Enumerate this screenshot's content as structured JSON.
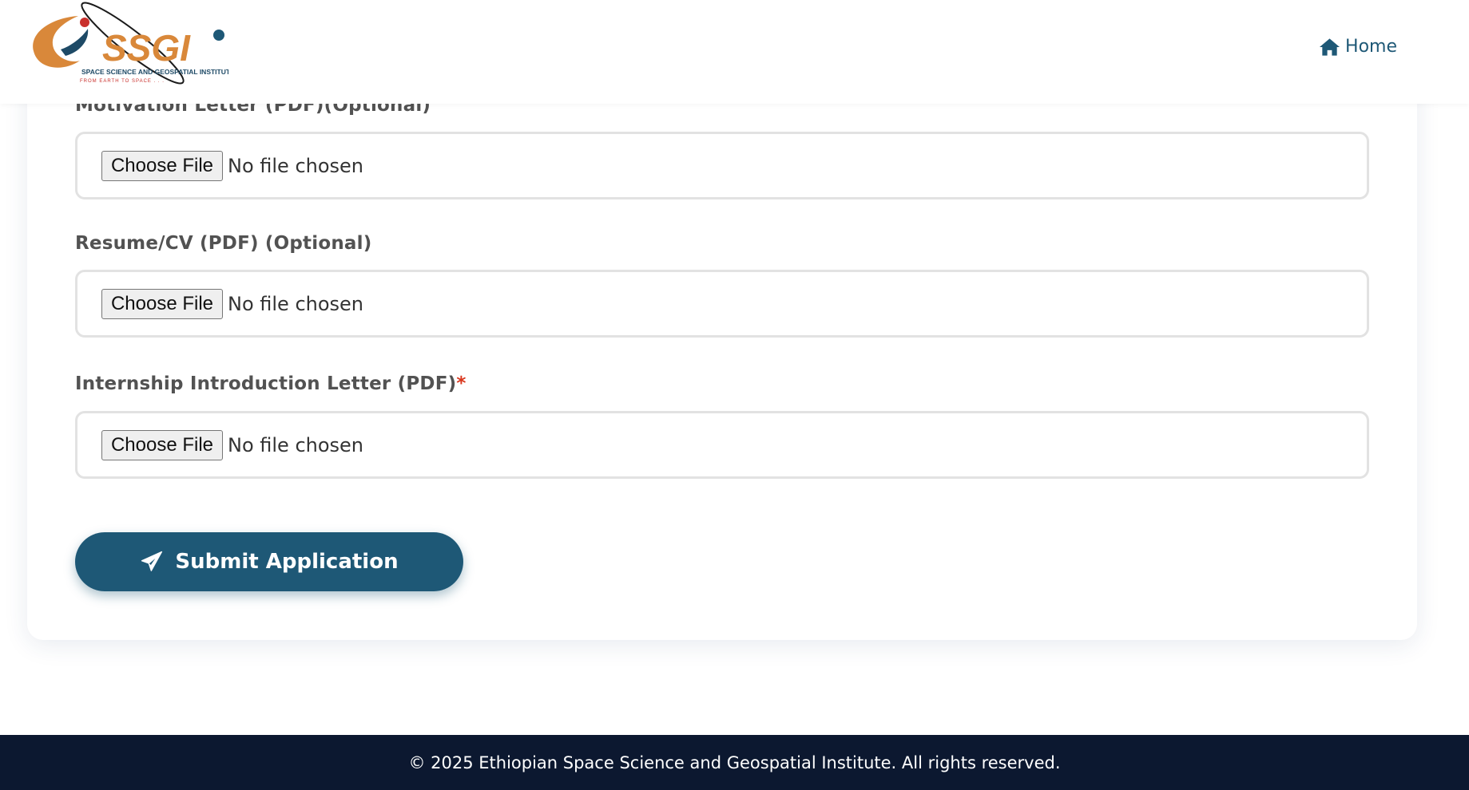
{
  "header": {
    "logo": {
      "wordmark": "SSGI",
      "tagline": "SPACE SCIENCE AND GEOSPATIAL INSTITUTE",
      "motto": "FROM EARTH TO SPACE . . ."
    },
    "nav": {
      "home_label": "Home",
      "home_icon": "home-icon"
    }
  },
  "form": {
    "motivation": {
      "label": "Motivation Letter (PDF)(Optional)",
      "button": "Choose File",
      "status": "No file chosen"
    },
    "resume": {
      "label": "Resume/CV (PDF) (Optional)",
      "button": "Choose File",
      "status": "No file chosen"
    },
    "internship": {
      "label": "Internship Introduction Letter (PDF)",
      "required_mark": "*",
      "button": "Choose File",
      "status": "No file chosen"
    },
    "submit": {
      "label": "Submit Application",
      "icon": "paper-plane-icon"
    }
  },
  "footer": {
    "text": "© 2025 Ethiopian Space Science and Geospatial Institute. All rights reserved."
  },
  "colors": {
    "primary": "#1e5876",
    "footer_bg": "#0c1830",
    "required": "#d9361c",
    "logo_orange": "#d9883a"
  }
}
